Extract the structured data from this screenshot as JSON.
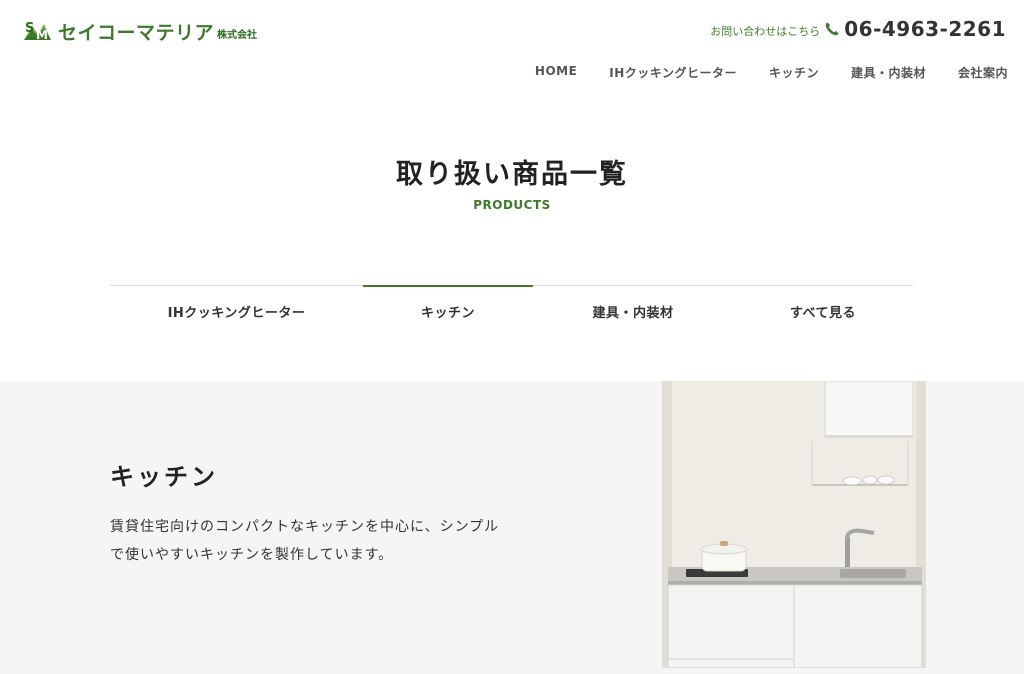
{
  "header": {
    "company_name": "セイコーマテリア",
    "company_suffix": "株式会社",
    "contact_label": "お問い合わせはこちら",
    "phone": "06-4963-2261"
  },
  "nav": {
    "items": [
      "HOME",
      "IHクッキングヒーター",
      "キッチン",
      "建具・内装材",
      "会社案内"
    ]
  },
  "page": {
    "title": "取り扱い商品一覧",
    "subtitle": "PRODUCTS"
  },
  "tabs": {
    "items": [
      "IHクッキングヒーター",
      "キッチン",
      "建具・内装材",
      "すべて見る"
    ],
    "active": "キッチン"
  },
  "product": {
    "heading": "キッチン",
    "description": "賃貸住宅向けのコンパクトなキッチンを中心に、シンプルで使いやすいキッチンを製作しています。"
  },
  "colors": {
    "accent_green": "#3f7a2a",
    "section_bg": "#f5f5f5"
  },
  "icons": {
    "phone": "phone-icon",
    "logo": "sm-logo-icon"
  }
}
